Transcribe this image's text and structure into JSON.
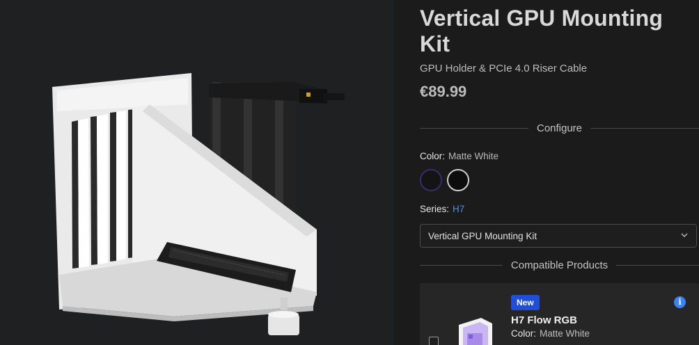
{
  "product": {
    "title": "Vertical GPU Mounting Kit",
    "subtitle": "GPU Holder & PCIe 4.0 Riser Cable",
    "price": "€89.99"
  },
  "configure": {
    "heading": "Configure",
    "color_label": "Color:",
    "color_value": "Matte White",
    "swatches": [
      {
        "name": "Matte White",
        "color": "#141414",
        "selected": true
      },
      {
        "name": "Matte Black",
        "color": "#0d0d0d",
        "selected": false
      }
    ],
    "series_label": "Series:",
    "series_value": "H7",
    "select_value": "Vertical GPU Mounting Kit"
  },
  "compatible": {
    "heading": "Compatible Products",
    "items": [
      {
        "badge": "New",
        "name": "H7 Flow RGB",
        "color_label": "Color:",
        "color_value": "Matte White"
      }
    ]
  },
  "colors": {
    "accent_blue": "#1f4fd8",
    "link_blue": "#4f8fe0",
    "info_blue": "#3b82f6"
  },
  "icons": [
    "chevron-down-icon",
    "info-icon"
  ]
}
